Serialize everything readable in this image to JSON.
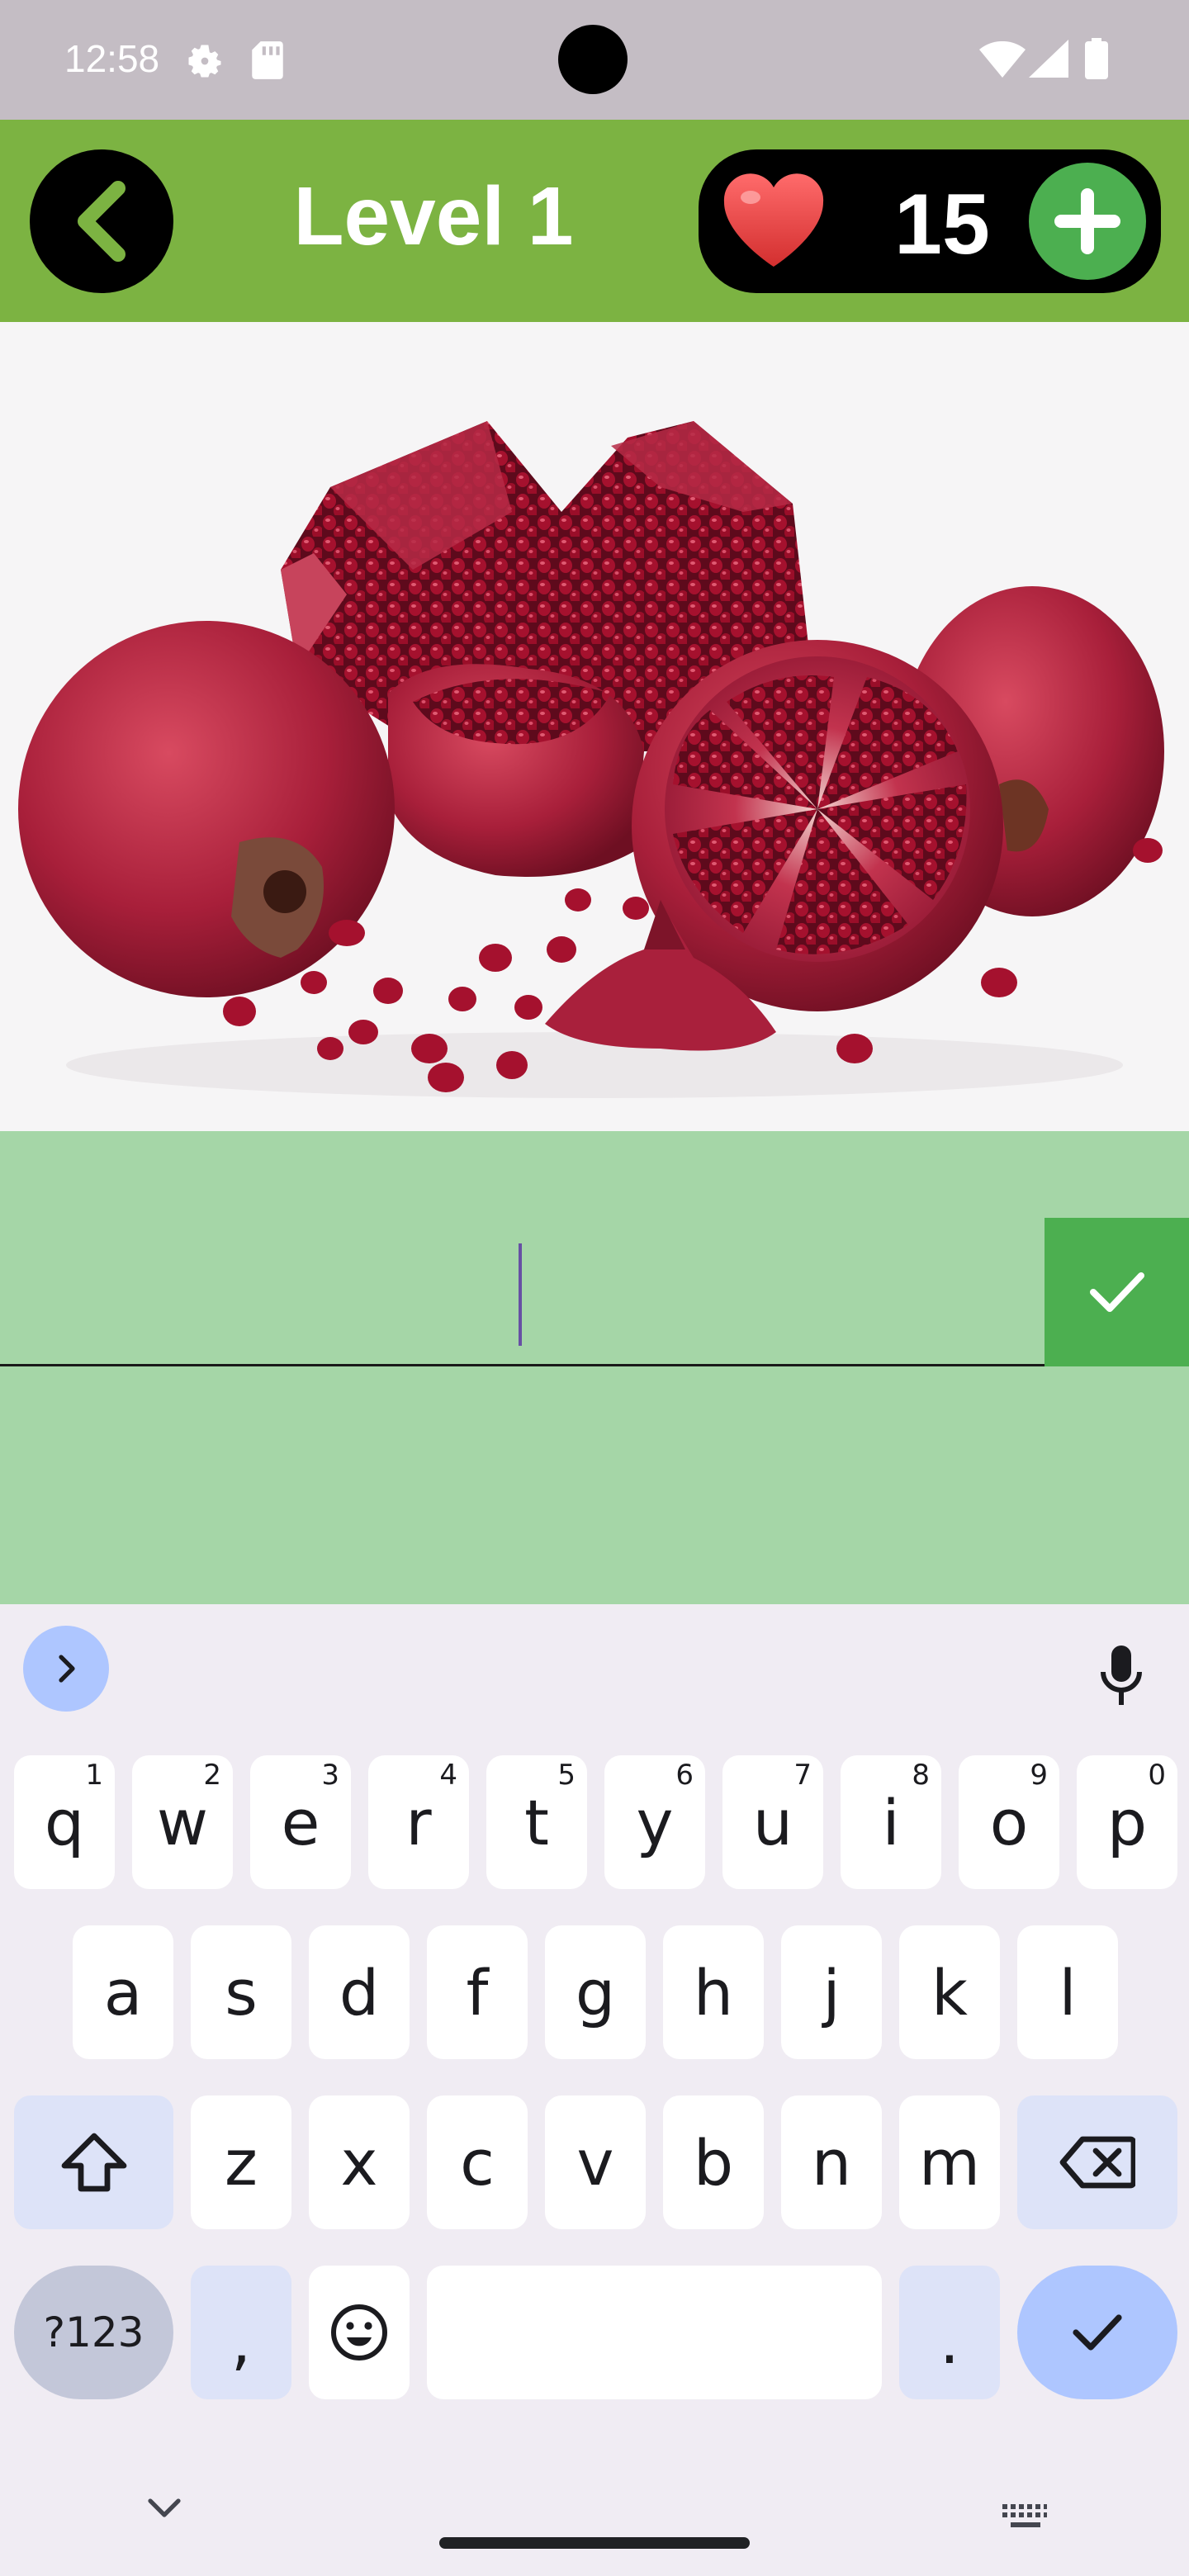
{
  "status_bar": {
    "time": "12:58",
    "icons": [
      "settings-icon",
      "sd-card-icon",
      "wifi-icon",
      "signal-icon",
      "battery-icon"
    ]
  },
  "header": {
    "title": "Level 1",
    "lives": "15",
    "colors": {
      "background": "#7cb342",
      "add_button": "#4caf50",
      "heart": "#e53935"
    }
  },
  "puzzle": {
    "image_subject": "pomegranates"
  },
  "answer": {
    "value": "",
    "placeholder": "",
    "colors": {
      "background": "#a5d6a7",
      "submit": "#4caf50",
      "caret": "#6750a4"
    }
  },
  "keyboard": {
    "row1": [
      {
        "key": "q",
        "hint": "1"
      },
      {
        "key": "w",
        "hint": "2"
      },
      {
        "key": "e",
        "hint": "3"
      },
      {
        "key": "r",
        "hint": "4"
      },
      {
        "key": "t",
        "hint": "5"
      },
      {
        "key": "y",
        "hint": "6"
      },
      {
        "key": "u",
        "hint": "7"
      },
      {
        "key": "i",
        "hint": "8"
      },
      {
        "key": "o",
        "hint": "9"
      },
      {
        "key": "p",
        "hint": "0"
      }
    ],
    "row2": [
      "a",
      "s",
      "d",
      "f",
      "g",
      "h",
      "j",
      "k",
      "l"
    ],
    "row3": [
      "z",
      "x",
      "c",
      "v",
      "b",
      "n",
      "m"
    ],
    "symbols_label": "?123",
    "comma": ",",
    "period": ".",
    "accent": "#aec6ff"
  }
}
